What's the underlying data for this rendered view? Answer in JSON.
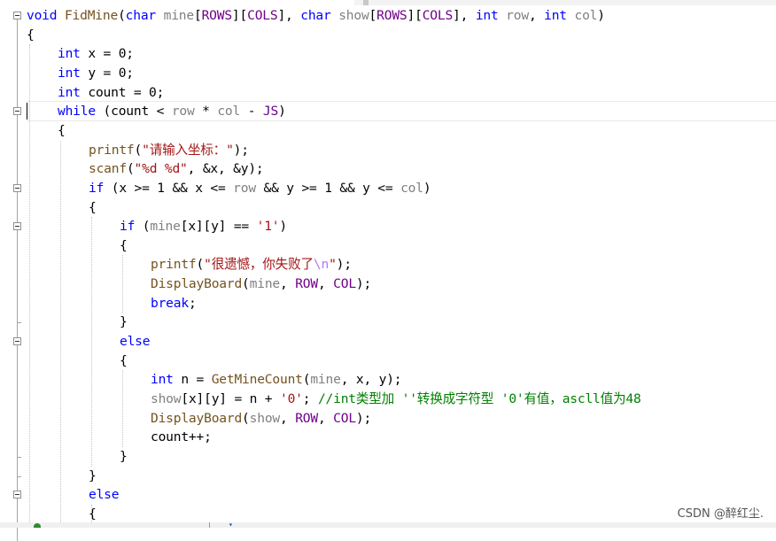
{
  "editor": {
    "lines": [
      {
        "indent": 0,
        "tokens": [
          [
            "ty",
            "void"
          ],
          [
            "pun",
            " "
          ],
          [
            "fn",
            "FidMine"
          ],
          [
            "pun",
            "("
          ],
          [
            "ty",
            "char"
          ],
          [
            "pun",
            " "
          ],
          [
            "var",
            "mine"
          ],
          [
            "pun",
            "["
          ],
          [
            "mac",
            "ROWS"
          ],
          [
            "pun",
            "]["
          ],
          [
            "mac",
            "COLS"
          ],
          [
            "pun",
            "], "
          ],
          [
            "ty",
            "char"
          ],
          [
            "pun",
            " "
          ],
          [
            "var",
            "show"
          ],
          [
            "pun",
            "["
          ],
          [
            "mac",
            "ROWS"
          ],
          [
            "pun",
            "]["
          ],
          [
            "mac",
            "COLS"
          ],
          [
            "pun",
            "], "
          ],
          [
            "ty",
            "int"
          ],
          [
            "pun",
            " "
          ],
          [
            "var",
            "row"
          ],
          [
            "pun",
            ", "
          ],
          [
            "ty",
            "int"
          ],
          [
            "pun",
            " "
          ],
          [
            "var",
            "col"
          ],
          [
            "pun",
            ")"
          ]
        ]
      },
      {
        "indent": 0,
        "tokens": [
          [
            "pun",
            "{"
          ]
        ]
      },
      {
        "indent": 1,
        "tokens": [
          [
            "ty",
            "int"
          ],
          [
            "pun",
            " x = 0;"
          ]
        ]
      },
      {
        "indent": 1,
        "tokens": [
          [
            "ty",
            "int"
          ],
          [
            "pun",
            " y = 0;"
          ]
        ]
      },
      {
        "indent": 1,
        "tokens": [
          [
            "ty",
            "int"
          ],
          [
            "pun",
            " count = 0;"
          ]
        ]
      },
      {
        "indent": 1,
        "tokens": [
          [
            "kw",
            "while"
          ],
          [
            "pun",
            " (count < "
          ],
          [
            "var",
            "row"
          ],
          [
            "pun",
            " * "
          ],
          [
            "var",
            "col"
          ],
          [
            "pun",
            " - "
          ],
          [
            "mac",
            "JS"
          ],
          [
            "pun",
            ")"
          ]
        ]
      },
      {
        "indent": 1,
        "tokens": [
          [
            "pun",
            "{"
          ]
        ]
      },
      {
        "indent": 2,
        "tokens": [
          [
            "fn",
            "printf"
          ],
          [
            "pun",
            "("
          ],
          [
            "str",
            "\"请输入坐标：\""
          ],
          [
            "pun",
            ");"
          ]
        ]
      },
      {
        "indent": 2,
        "tokens": [
          [
            "fn",
            "scanf"
          ],
          [
            "pun",
            "("
          ],
          [
            "str",
            "\"%d %d\""
          ],
          [
            "pun",
            ", &x, &y);"
          ]
        ]
      },
      {
        "indent": 2,
        "tokens": [
          [
            "kw",
            "if"
          ],
          [
            "pun",
            " (x >= 1 && x <= "
          ],
          [
            "var",
            "row"
          ],
          [
            "pun",
            " && y >= 1 && y <= "
          ],
          [
            "var",
            "col"
          ],
          [
            "pun",
            ")"
          ]
        ]
      },
      {
        "indent": 2,
        "tokens": [
          [
            "pun",
            "{"
          ]
        ]
      },
      {
        "indent": 3,
        "tokens": [
          [
            "kw",
            "if"
          ],
          [
            "pun",
            " ("
          ],
          [
            "var",
            "mine"
          ],
          [
            "pun",
            "[x][y] == "
          ],
          [
            "str",
            "'1'"
          ],
          [
            "pun",
            ")"
          ]
        ]
      },
      {
        "indent": 3,
        "tokens": [
          [
            "pun",
            "{"
          ]
        ]
      },
      {
        "indent": 4,
        "tokens": [
          [
            "fn",
            "printf"
          ],
          [
            "pun",
            "("
          ],
          [
            "str",
            "\"很遗憾，你失败了"
          ],
          [
            "esc",
            "\\n"
          ],
          [
            "str",
            "\""
          ],
          [
            "pun",
            ");"
          ]
        ]
      },
      {
        "indent": 4,
        "tokens": [
          [
            "fn",
            "DisplayBoard"
          ],
          [
            "pun",
            "("
          ],
          [
            "var",
            "mine"
          ],
          [
            "pun",
            ", "
          ],
          [
            "mac",
            "ROW"
          ],
          [
            "pun",
            ", "
          ],
          [
            "mac",
            "COL"
          ],
          [
            "pun",
            ");"
          ]
        ]
      },
      {
        "indent": 4,
        "tokens": [
          [
            "kw",
            "break"
          ],
          [
            "pun",
            ";"
          ]
        ]
      },
      {
        "indent": 3,
        "tokens": [
          [
            "pun",
            "}"
          ]
        ]
      },
      {
        "indent": 3,
        "tokens": [
          [
            "kw",
            "else"
          ]
        ]
      },
      {
        "indent": 3,
        "tokens": [
          [
            "pun",
            "{"
          ]
        ]
      },
      {
        "indent": 4,
        "tokens": [
          [
            "ty",
            "int"
          ],
          [
            "pun",
            " n = "
          ],
          [
            "fn",
            "GetMineCount"
          ],
          [
            "pun",
            "("
          ],
          [
            "var",
            "mine"
          ],
          [
            "pun",
            ", x, y);"
          ]
        ]
      },
      {
        "indent": 4,
        "tokens": [
          [
            "var",
            "show"
          ],
          [
            "pun",
            "[x][y] = n + "
          ],
          [
            "str",
            "'0'"
          ],
          [
            "pun",
            "; "
          ],
          [
            "cm",
            "//int类型加 ''转换成字符型 '0'有值，ascll值为48"
          ]
        ]
      },
      {
        "indent": 4,
        "tokens": [
          [
            "fn",
            "DisplayBoard"
          ],
          [
            "pun",
            "("
          ],
          [
            "var",
            "show"
          ],
          [
            "pun",
            ", "
          ],
          [
            "mac",
            "ROW"
          ],
          [
            "pun",
            ", "
          ],
          [
            "mac",
            "COL"
          ],
          [
            "pun",
            ");"
          ]
        ]
      },
      {
        "indent": 4,
        "tokens": [
          [
            "pun",
            "count++;"
          ]
        ]
      },
      {
        "indent": 3,
        "tokens": [
          [
            "pun",
            "}"
          ]
        ]
      },
      {
        "indent": 2,
        "tokens": [
          [
            "pun",
            "}"
          ]
        ]
      },
      {
        "indent": 2,
        "tokens": [
          [
            "kw",
            "else"
          ]
        ]
      },
      {
        "indent": 2,
        "tokens": [
          [
            "pun",
            "{"
          ]
        ]
      }
    ]
  },
  "watermark": "CSDN @醉红尘."
}
